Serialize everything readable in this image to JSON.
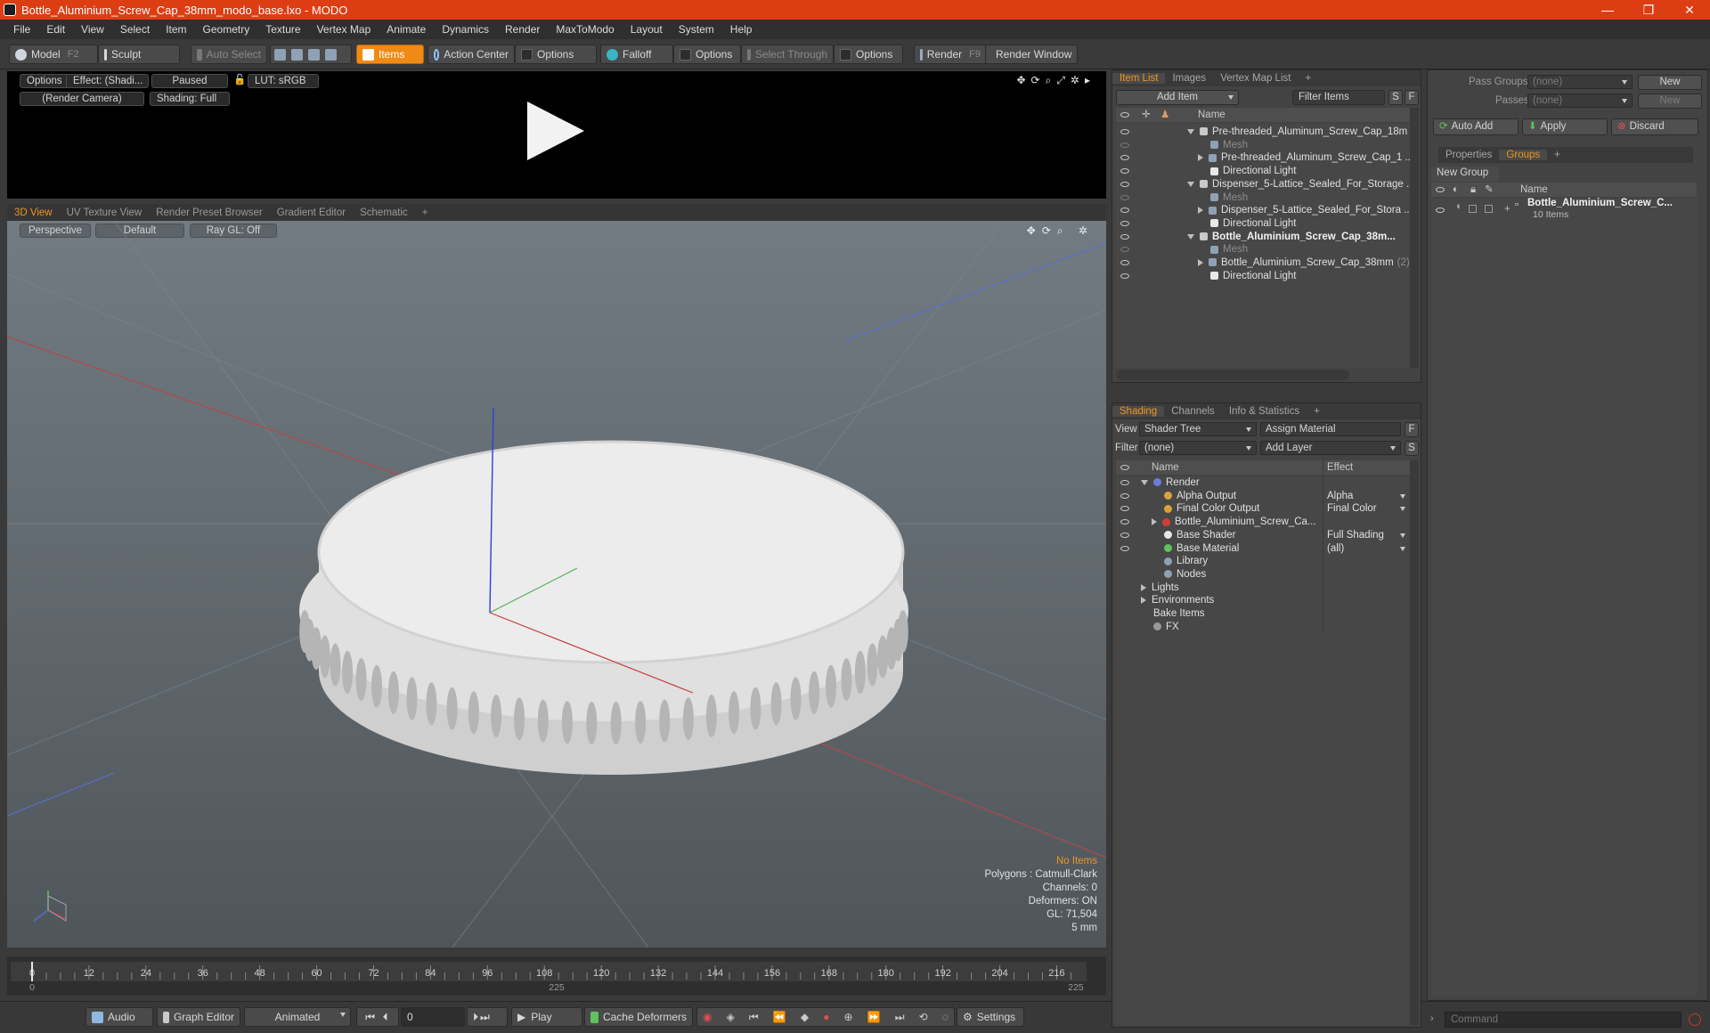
{
  "window": {
    "title": "Bottle_Aluminium_Screw_Cap_38mm_modo_base.lxo - MODO",
    "controls": [
      "—",
      "❐",
      "✕"
    ]
  },
  "menu": [
    "File",
    "Edit",
    "View",
    "Select",
    "Item",
    "Geometry",
    "Texture",
    "Vertex Map",
    "Animate",
    "Dynamics",
    "Render",
    "MaxToModo",
    "Layout",
    "System",
    "Help"
  ],
  "toolbar": {
    "model": "Model",
    "model_hotkey": "F2",
    "sculpt": "Sculpt",
    "auto_select": "Auto Select",
    "items": "Items",
    "action_center": "Action Center",
    "options1": "Options",
    "falloff": "Falloff",
    "options2": "Options",
    "select_through": "Select Through",
    "options3": "Options",
    "render": "Render",
    "render_hotkey": "F9",
    "render_window": "Render Window"
  },
  "preview": {
    "options": "Options",
    "effect": "Effect: (Shadi...",
    "paused": "Paused",
    "lut": "LUT: sRGB",
    "camera": "(Render Camera)",
    "shading": "Shading: Full"
  },
  "viewport_tabs": [
    {
      "label": "3D View",
      "active": true
    },
    {
      "label": "UV Texture View"
    },
    {
      "label": "Render Preset Browser"
    },
    {
      "label": "Gradient Editor"
    },
    {
      "label": "Schematic"
    },
    {
      "label": "+"
    }
  ],
  "viewport": {
    "perspective": "Perspective",
    "default": "Default",
    "raygl": "Ray GL: Off",
    "stats": {
      "no_items": "No Items",
      "polygons": "Polygons : Catmull-Clark",
      "channels": "Channels: 0",
      "deformers": "Deformers: ON",
      "gl": "GL: 71,504",
      "unit": "5 mm"
    }
  },
  "timeline": {
    "ticks": [
      "0",
      "12",
      "24",
      "36",
      "48",
      "60",
      "72",
      "84",
      "96",
      "108",
      "120",
      "132",
      "144",
      "156",
      "168",
      "180",
      "192",
      "204",
      "216"
    ],
    "bottom": [
      "0",
      "225",
      "225"
    ]
  },
  "bottom": {
    "audio": "Audio",
    "graph_editor": "Graph Editor",
    "animated": "Animated",
    "frame": "0",
    "play": "Play",
    "cache_deformers": "Cache Deformers",
    "settings": "Settings",
    "command_placeholder": "Command"
  },
  "item_list": {
    "tabs": [
      {
        "label": "Item List",
        "active": true
      },
      {
        "label": "Images"
      },
      {
        "label": "Vertex Map List"
      },
      {
        "label": "+"
      }
    ],
    "add_item": "Add Item",
    "filter_items": "Filter Items",
    "s": "S",
    "f": "F",
    "name_col": "Name",
    "rows": [
      {
        "label": "Pre-threaded_Aluminum_Screw_Cap_18m ...",
        "kind": "scene",
        "indent": 0,
        "open": true
      },
      {
        "label": "Mesh",
        "kind": "mesh",
        "indent": 1,
        "dim": true
      },
      {
        "label": "Pre-threaded_Aluminum_Screw_Cap_1 ...",
        "kind": "mesh",
        "indent": 1,
        "collapsed": true
      },
      {
        "label": "Directional Light",
        "kind": "light",
        "indent": 1
      },
      {
        "label": "Dispenser_5-Lattice_Sealed_For_Storage ...",
        "kind": "scene",
        "indent": 0,
        "open": true
      },
      {
        "label": "Mesh",
        "kind": "mesh",
        "indent": 1,
        "dim": true
      },
      {
        "label": "Dispenser_5-Lattice_Sealed_For_Stora ...",
        "kind": "mesh",
        "indent": 1,
        "collapsed": true
      },
      {
        "label": "Directional Light",
        "kind": "light",
        "indent": 1
      },
      {
        "label": "Bottle_Aluminium_Screw_Cap_38m...",
        "kind": "scene",
        "indent": 0,
        "open": true,
        "bold": true
      },
      {
        "label": "Mesh",
        "kind": "mesh",
        "indent": 1,
        "dim": true
      },
      {
        "label": "Bottle_Aluminium_Screw_Cap_38mm",
        "suffix": "(2)",
        "kind": "mesh",
        "indent": 1,
        "collapsed": true
      },
      {
        "label": "Directional Light",
        "kind": "light",
        "indent": 1
      }
    ]
  },
  "shading": {
    "tabs": [
      {
        "label": "Shading",
        "active": true
      },
      {
        "label": "Channels"
      },
      {
        "label": "Info & Statistics"
      },
      {
        "label": "+"
      }
    ],
    "view_label": "View",
    "view_value": "Shader Tree",
    "assign_material": "Assign Material",
    "f": "F",
    "filter_label": "Filter",
    "filter_value": "(none)",
    "add_layer": "Add Layer",
    "s": "S",
    "name_col": "Name",
    "effect_col": "Effect",
    "rows": [
      {
        "label": "Render",
        "effect": "",
        "indent": 0,
        "open": true,
        "color": "#6f7bd6"
      },
      {
        "label": "Alpha Output",
        "effect": "Alpha",
        "indent": 1,
        "color": "#d8a23c"
      },
      {
        "label": "Final Color Output",
        "effect": "Final Color",
        "indent": 1,
        "color": "#d8a23c"
      },
      {
        "label": "Bottle_Aluminium_Screw_Ca...",
        "effect": "",
        "indent": 1,
        "collapsed": true,
        "color": "#d43b3b"
      },
      {
        "label": "Base Shader",
        "effect": "Full Shading",
        "indent": 1,
        "color": "#e6e6e6"
      },
      {
        "label": "Base Material",
        "effect": "(all)",
        "indent": 1,
        "color": "#5fc25a"
      },
      {
        "label": "Library",
        "effect": "",
        "indent": 1,
        "color": "#8fa1b5",
        "noeye": true
      },
      {
        "label": "Nodes",
        "effect": "",
        "indent": 1,
        "color": "#8fa1b5",
        "noeye": true
      },
      {
        "label": "Lights",
        "effect": "",
        "indent": 0,
        "collapsed": true,
        "noeye": true
      },
      {
        "label": "Environments",
        "effect": "",
        "indent": 0,
        "collapsed": true,
        "noeye": true
      },
      {
        "label": "Bake Items",
        "effect": "",
        "indent": 0,
        "noeye": true
      },
      {
        "label": "FX",
        "effect": "",
        "indent": 0,
        "color": "#9a9a9a",
        "noeye": true
      }
    ]
  },
  "groups_panel": {
    "pass_groups": "Pass Groups",
    "pass_groups_value": "(none)",
    "new1": "New",
    "passes": "Passes",
    "passes_value": "(none)",
    "new2": "New",
    "auto_add": "Auto Add",
    "apply": "Apply",
    "discard": "Discard",
    "tabs": [
      {
        "label": "Properties"
      },
      {
        "label": "Groups",
        "active": true
      },
      {
        "label": "+"
      }
    ],
    "new_group": "New Group",
    "name_col": "Name",
    "group_name": "Bottle_Aluminium_Screw_C...",
    "group_count": "10 Items"
  }
}
